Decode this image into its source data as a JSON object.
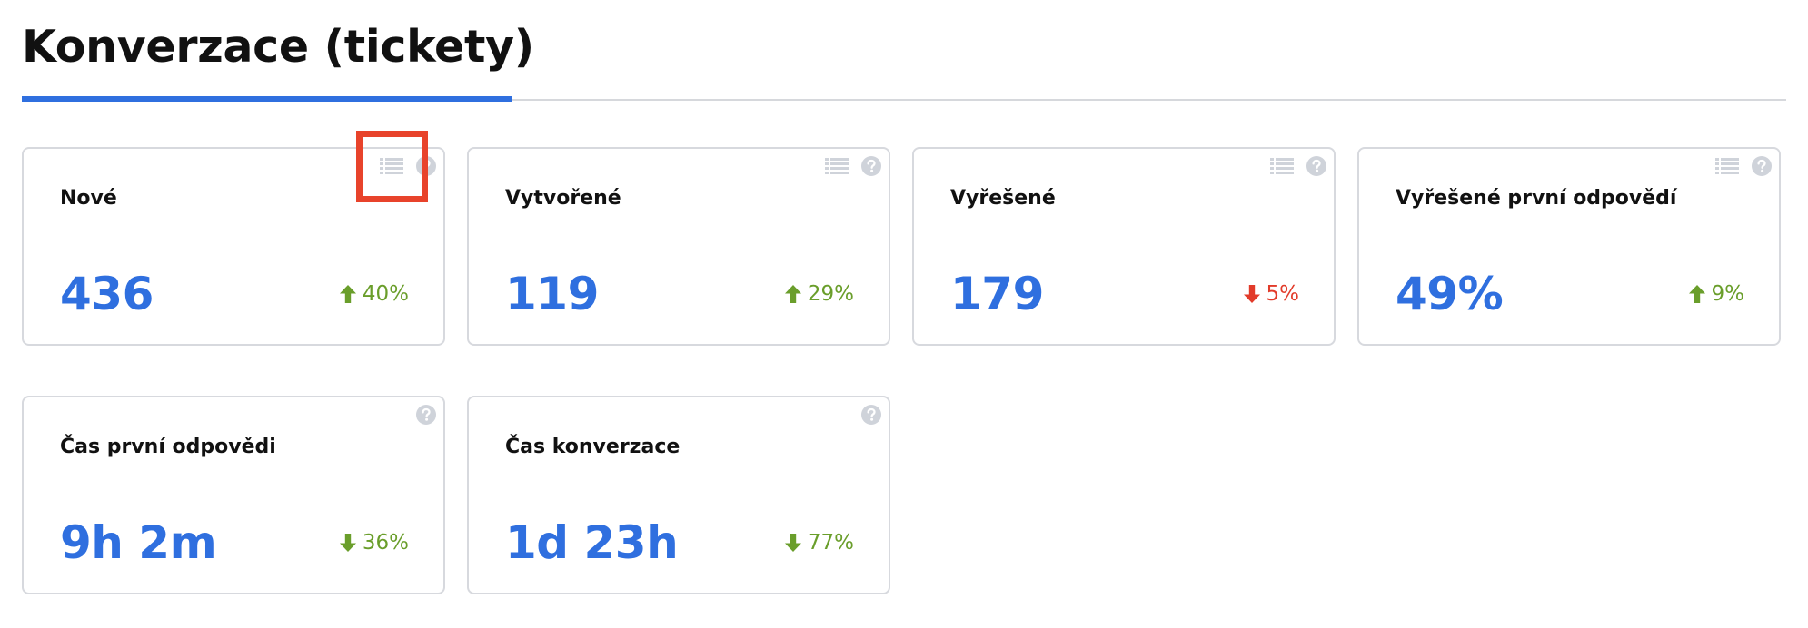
{
  "section": {
    "title": "Konverzace (tickety)"
  },
  "colors": {
    "accent": "#2f6fdf",
    "positive": "#6a9e2b",
    "negative": "#e23b2a",
    "icon": "#cfd3da",
    "highlight": "#e8432b"
  },
  "cards": [
    {
      "label": "Nové",
      "value": "436",
      "change": "40%",
      "trend": "up",
      "sentiment": "positive",
      "icons": [
        "list-icon",
        "help-icon"
      ]
    },
    {
      "label": "Vytvořené",
      "value": "119",
      "change": "29%",
      "trend": "up",
      "sentiment": "positive",
      "icons": [
        "list-icon",
        "help-icon"
      ]
    },
    {
      "label": "Vyřešené",
      "value": "179",
      "change": "5%",
      "trend": "down",
      "sentiment": "negative",
      "icons": [
        "list-icon",
        "help-icon"
      ]
    },
    {
      "label": "Vyřešené první odpovědí",
      "value": "49%",
      "change": "9%",
      "trend": "up",
      "sentiment": "positive",
      "icons": [
        "list-icon",
        "help-icon"
      ]
    },
    {
      "label": "Čas první odpovědi",
      "value": "9h 2m",
      "change": "36%",
      "trend": "down",
      "sentiment": "positive",
      "icons": [
        "help-icon"
      ]
    },
    {
      "label": "Čas konverzace",
      "value": "1d 23h",
      "change": "77%",
      "trend": "down",
      "sentiment": "positive",
      "icons": [
        "help-icon"
      ]
    }
  ]
}
